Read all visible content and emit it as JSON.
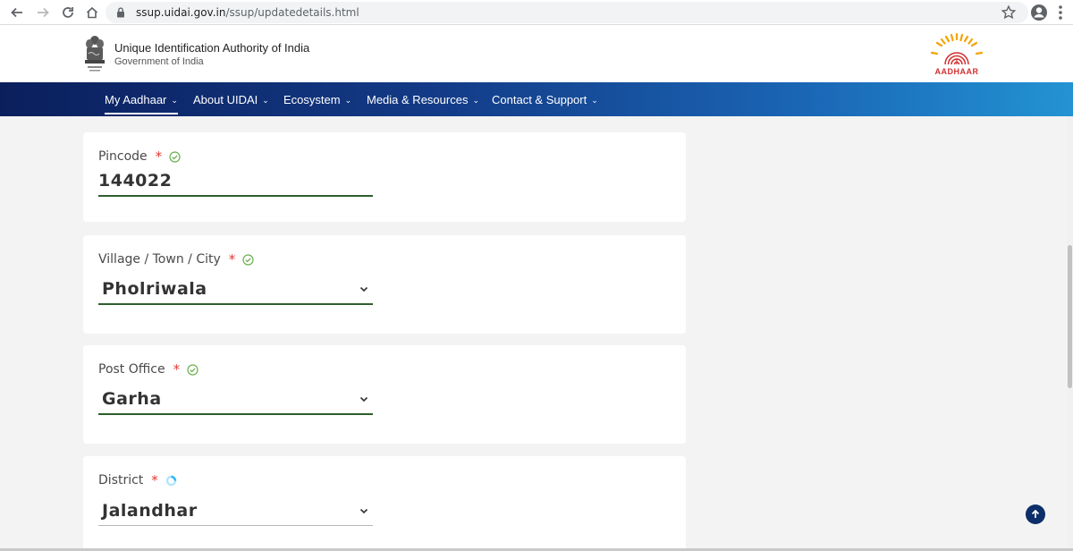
{
  "browser": {
    "url_host": "ssup.uidai.gov.in",
    "url_path": "/ssup/updatedetails.html"
  },
  "header": {
    "org_name": "Unique Identification Authority of India",
    "org_sub": "Government of India",
    "logo_text": "AADHAAR"
  },
  "nav": {
    "items": [
      {
        "label": "My Aadhaar",
        "active": true
      },
      {
        "label": "About UIDAI"
      },
      {
        "label": "Ecosystem"
      },
      {
        "label": "Media & Resources"
      },
      {
        "label": "Contact & Support"
      }
    ]
  },
  "form": {
    "pincode": {
      "label": "Pincode",
      "value": "144022"
    },
    "city": {
      "label": "Village / Town / City",
      "value": "Pholriwala"
    },
    "post_office": {
      "label": "Post Office",
      "value": "Garha"
    },
    "district": {
      "label": "District",
      "value": "Jalandhar"
    }
  },
  "colors": {
    "nav_start": "#0b1f5c",
    "nav_end": "#2393d3",
    "field_underline": "#2e5e2e",
    "required": "#e53935",
    "check": "#6ab04c",
    "loading": "#4fc3f7"
  }
}
